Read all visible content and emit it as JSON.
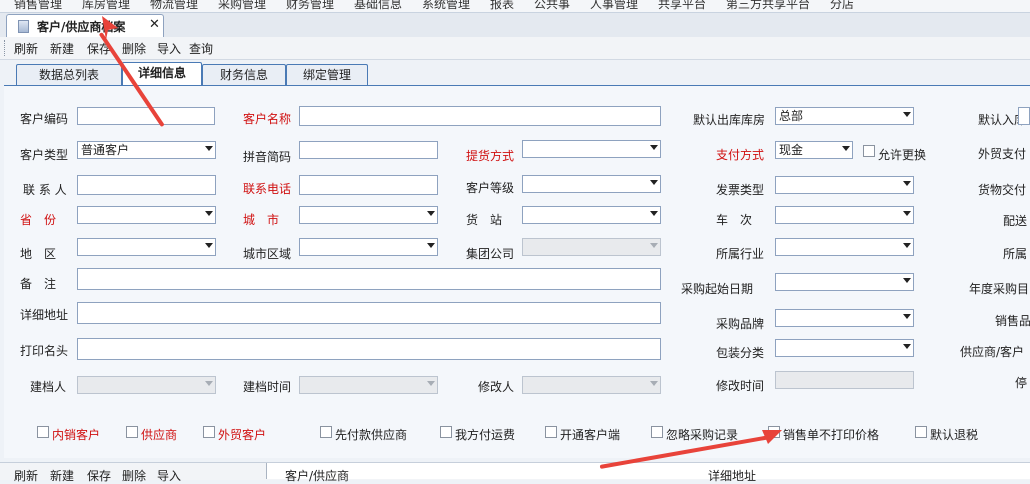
{
  "menu": [
    "销售管理",
    "库房管理",
    "物流管理",
    "采购管理",
    "财务管理",
    "基础信息",
    "系统管理",
    "报表",
    "公共事",
    "人事管理",
    "共享平台",
    "第三方共享平台",
    "分店"
  ],
  "doc_tab": {
    "title": "客户/供应商档案",
    "close": "✕"
  },
  "toolbar": [
    "刷新",
    "新建",
    "保存",
    "删除",
    "导入",
    "查询"
  ],
  "subtabs": [
    "数据总列表",
    "详细信息",
    "财务信息",
    "绑定管理"
  ],
  "form": {
    "customer_code": {
      "label": "客户编码",
      "value": ""
    },
    "customer_name": {
      "label": "客户名称",
      "value": ""
    },
    "default_out_warehouse": {
      "label": "默认出库库房",
      "value": "总部"
    },
    "default_in_warehouse": {
      "label": "默认入库"
    },
    "customer_type": {
      "label": "客户类型",
      "value": "普通客户"
    },
    "pinyin": {
      "label": "拼音简码",
      "value": ""
    },
    "pickup_method": {
      "label": "提货方式",
      "value": ""
    },
    "pay_method": {
      "label": "支付方式",
      "value": "现金"
    },
    "allow_change": {
      "label": "允许更换"
    },
    "foreign_pay": {
      "label": "外贸支付"
    },
    "contact": {
      "label": "联 系 人",
      "value": ""
    },
    "contact_phone": {
      "label": "联系电话",
      "value": ""
    },
    "customer_level": {
      "label": "客户等级",
      "value": ""
    },
    "invoice_type": {
      "label": "发票类型",
      "value": ""
    },
    "goods_delivery": {
      "label": "货物交付"
    },
    "province": {
      "label": "省　份",
      "value": ""
    },
    "city": {
      "label": "城　市",
      "value": ""
    },
    "station": {
      "label": "货　站",
      "value": ""
    },
    "train": {
      "label": "车　次",
      "value": ""
    },
    "delivery": {
      "label": "配送"
    },
    "area": {
      "label": "地　区",
      "value": ""
    },
    "city_area": {
      "label": "城市区域",
      "value": ""
    },
    "group_company": {
      "label": "集团公司",
      "value": ""
    },
    "industry": {
      "label": "所属行业",
      "value": ""
    },
    "owned": {
      "label": "所属"
    },
    "remark": {
      "label": "备　注",
      "value": ""
    },
    "purchase_start": {
      "label": "采购起始日期",
      "value": ""
    },
    "annual_purchase": {
      "label": "年度采购目"
    },
    "address": {
      "label": "详细地址",
      "value": ""
    },
    "purchase_brand": {
      "label": "采购品牌",
      "value": ""
    },
    "sales_item": {
      "label": "销售品"
    },
    "print_name": {
      "label": "打印名头",
      "value": ""
    },
    "package_class": {
      "label": "包装分类",
      "value": ""
    },
    "supplier_customer": {
      "label": "供应商/客户"
    },
    "creator": {
      "label": "建档人",
      "value": ""
    },
    "create_time": {
      "label": "建档时间",
      "value": ""
    },
    "modifier": {
      "label": "修改人",
      "value": ""
    },
    "modify_time": {
      "label": "修改时间",
      "value": ""
    },
    "stop": {
      "label": "停"
    }
  },
  "checkboxes": [
    {
      "label": "内销客户",
      "red": true
    },
    {
      "label": "供应商",
      "red": true
    },
    {
      "label": "外贸客户",
      "red": true
    },
    {
      "label": "先付款供应商",
      "red": false
    },
    {
      "label": "我方付运费",
      "red": false
    },
    {
      "label": "开通客户端",
      "red": false
    },
    {
      "label": "忽略采购记录",
      "red": false
    },
    {
      "label": "销售单不打印价格",
      "red": false
    },
    {
      "label": "默认退税",
      "red": false
    }
  ],
  "bottom_toolbar": [
    "刷新",
    "新建",
    "保存",
    "删除",
    "导入"
  ],
  "grid_headers": [
    "客户/供应商",
    "详细地址"
  ],
  "colors": {
    "required_label": "#d01010",
    "tab_border": "#4a7ab5",
    "annotation_arrow": "#e8433a"
  }
}
